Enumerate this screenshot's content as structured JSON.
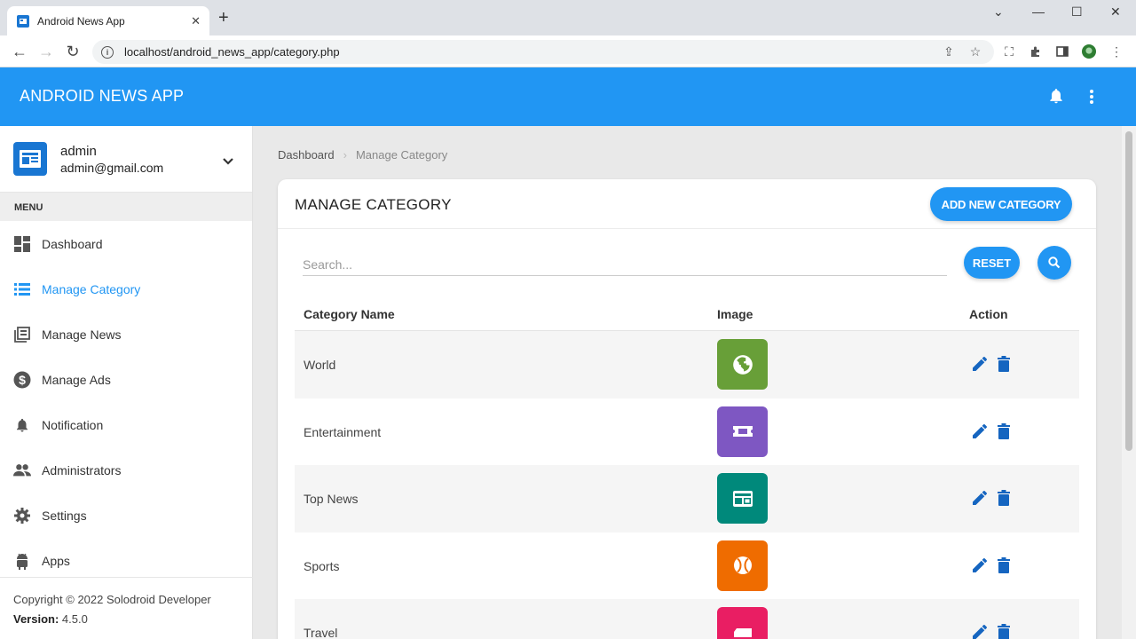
{
  "browser": {
    "tab_title": "Android News App",
    "url": "localhost/android_news_app/category.php"
  },
  "app": {
    "title": "ANDROID NEWS APP"
  },
  "user": {
    "name": "admin",
    "email": "admin@gmail.com"
  },
  "sidebar": {
    "menu_heading": "MENU",
    "items": [
      {
        "label": "Dashboard",
        "icon": "dashboard-icon"
      },
      {
        "label": "Manage Category",
        "icon": "list-icon",
        "active": true
      },
      {
        "label": "Manage News",
        "icon": "news-icon"
      },
      {
        "label": "Manage Ads",
        "icon": "dollar-icon"
      },
      {
        "label": "Notification",
        "icon": "bell-icon"
      },
      {
        "label": "Administrators",
        "icon": "people-icon"
      },
      {
        "label": "Settings",
        "icon": "gear-icon"
      },
      {
        "label": "Apps",
        "icon": "android-icon"
      }
    ],
    "copyright": "Copyright © 2022 Solodroid Developer",
    "version_label": "Version:",
    "version_value": "4.5.0"
  },
  "breadcrumb": {
    "home": "Dashboard",
    "current": "Manage Category"
  },
  "card": {
    "title": "MANAGE CATEGORY",
    "add_button": "ADD NEW CATEGORY",
    "search_placeholder": "Search...",
    "reset_button": "RESET"
  },
  "table": {
    "headers": [
      "Category Name",
      "Image",
      "Action"
    ],
    "rows": [
      {
        "name": "World",
        "color": "#689f38",
        "icon": "globe-icon"
      },
      {
        "name": "Entertainment",
        "color": "#7e57c2",
        "icon": "ticket-icon"
      },
      {
        "name": "Top News",
        "color": "#00897b",
        "icon": "newspaper-icon"
      },
      {
        "name": "Sports",
        "color": "#ef6c00",
        "icon": "ball-icon"
      },
      {
        "name": "Travel",
        "color": "#e91e63",
        "icon": "truck-icon"
      }
    ]
  },
  "colors": {
    "primary": "#2196f3",
    "action_icon": "#1565c0"
  }
}
